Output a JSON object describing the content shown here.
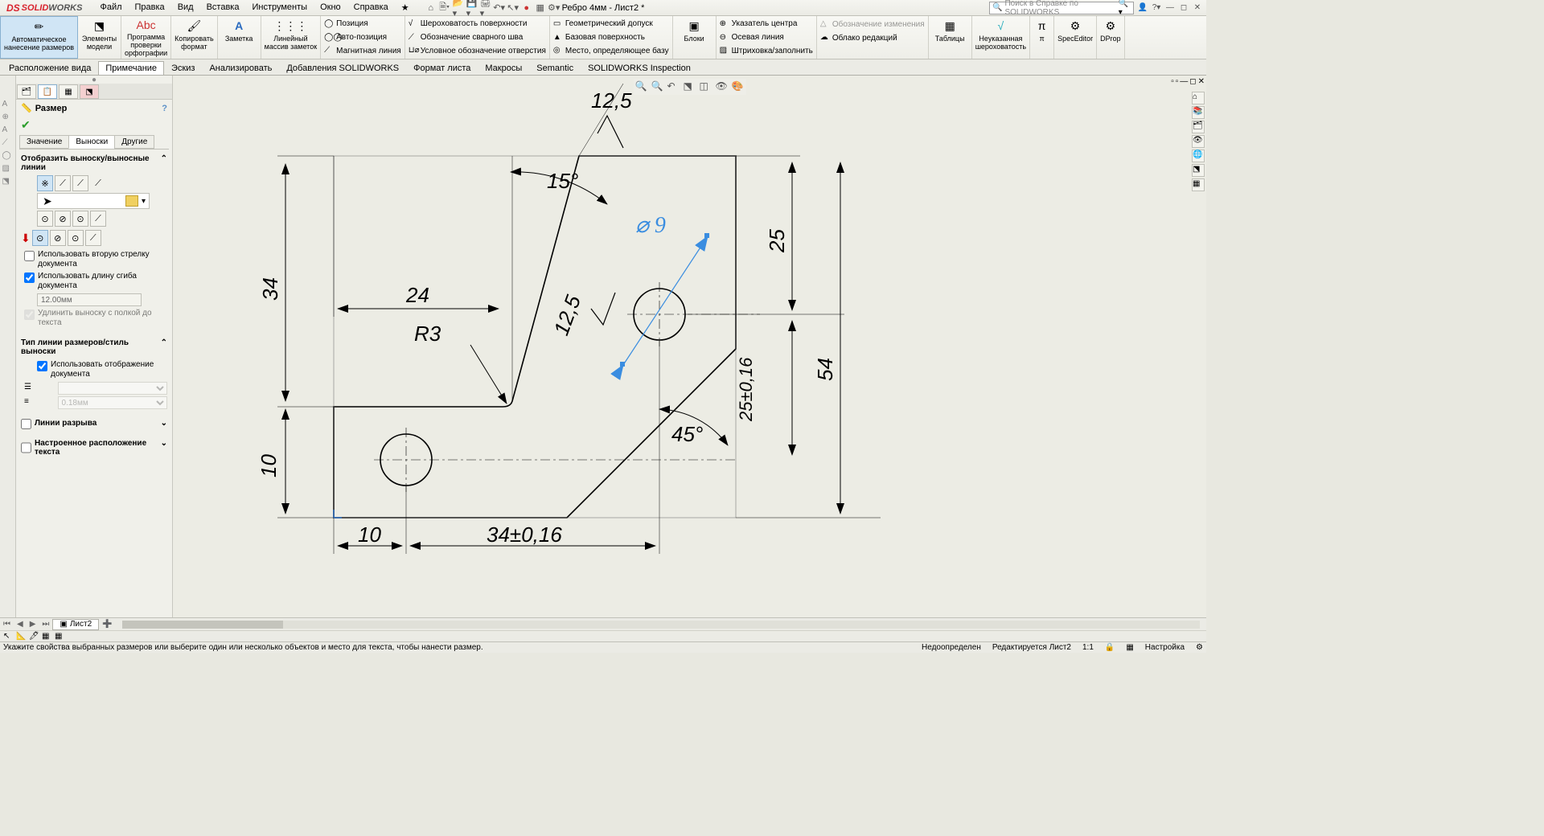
{
  "app": {
    "brand_ds": "DS",
    "brand_solid": "SOLID",
    "brand_works": "WORKS",
    "doc_title": "Ребро 4мм - Лист2 *"
  },
  "menu": [
    "Файл",
    "Правка",
    "Вид",
    "Вставка",
    "Инструменты",
    "Окно",
    "Справка"
  ],
  "search_placeholder": "Поиск в Справке по SOLIDWORKS",
  "ribbon": {
    "auto_dim": "Автоматическое\nнанесение размеров",
    "model_items": "Элементы\nмодели",
    "spell": "Программа\nпроверки\nорфографии",
    "copyfmt": "Копировать\nформат",
    "note": "Заметка",
    "linear_note": "Линейный\nмассив заметок",
    "position": "Позиция",
    "auto_position": "Авто-позиция",
    "magnetic": "Магнитная линия",
    "surface_rough": "Шероховатость поверхности",
    "weld_symbol": "Обозначение сварного шва",
    "hole_callout": "Условное обозначение отверстия",
    "geo_tol": "Геометрический допуск",
    "datum": "Базовая поверхность",
    "datum_target": "Место, определяющее базу",
    "blocks": "Блоки",
    "center_mark": "Указатель центра",
    "centerline": "Осевая линия",
    "hatch": "Штриховка/заполнить",
    "rev_symbol": "Обозначение изменения",
    "rev_cloud": "Облако редакций",
    "tables": "Таблицы",
    "unspec_rough": "Неуказанная\nшероховатость",
    "tt": "π",
    "spec": "SpecEditor",
    "dprop": "DProp"
  },
  "cmdtabs": [
    "Расположение вида",
    "Примечание",
    "Эскиз",
    "Анализировать",
    "Добавления SOLIDWORKS",
    "Формат листа",
    "Макросы",
    "Semantic",
    "SOLIDWORKS Inspection"
  ],
  "cmdtab_active": 1,
  "panel": {
    "title": "Размер",
    "subtabs": [
      "Значение",
      "Выноски",
      "Другие"
    ],
    "subtab_active": 1,
    "sect_display": "Отобразить выноску/выносные линии",
    "use_second_arrow": "Использовать вторую стрелку документа",
    "use_bend_length": "Использовать длину сгиба документа",
    "bend_value": "12.00мм",
    "extend_leader": "Удлинить выноску с полкой до текста",
    "sect_linetype": "Тип линии размеров/стиль выноски",
    "use_doc_display": "Использовать отображение документа",
    "thickness": "0.18мм",
    "sect_break": "Линии разрыва",
    "sect_custom": "Настроенное расположение текста"
  },
  "dimensions": {
    "d125a": "12,5",
    "d15": "15°",
    "d24": "24",
    "r3": "R3",
    "d34": "34",
    "d125b": "12,5",
    "dia9": "⌀ 9",
    "d25": "25",
    "d45": "45°",
    "d25tol": "25±0,16",
    "d54": "54",
    "d10a": "10",
    "d10b": "10",
    "d34tol": "34±0,16"
  },
  "sheet": {
    "name": "Лист2"
  },
  "status": {
    "hint": "Укажите свойства выбранных размеров или выберите один или несколько объектов и место для текста, чтобы нанести размер.",
    "under": "Недоопределен",
    "editing": "Редактируется Лист2",
    "scale": "1:1",
    "custom": "Настройка"
  }
}
